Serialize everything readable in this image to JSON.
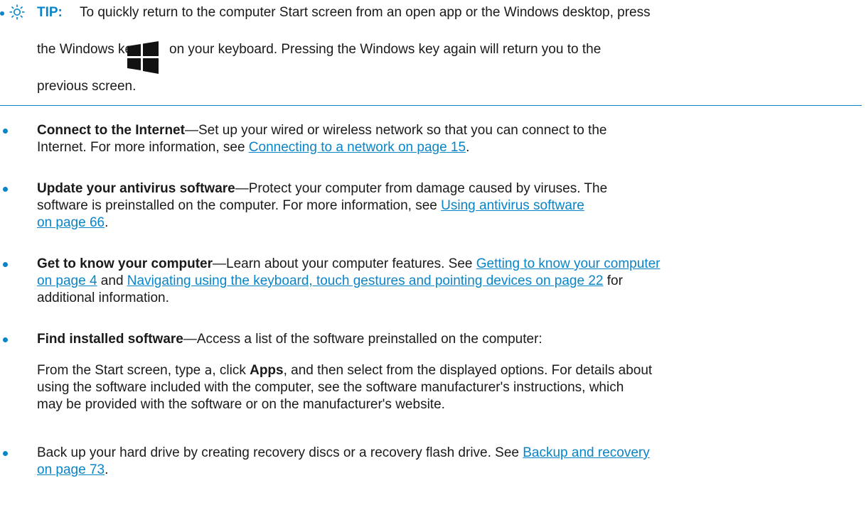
{
  "tip": {
    "label": "TIP:",
    "line1": "To quickly return to the computer Start screen from an open app or the Windows desktop, press",
    "line2a": "the Windows key",
    "line2b": "on your keyboard. Pressing the Windows key again will return you to the",
    "line3": "previous screen."
  },
  "items": [
    {
      "bold": "Connect to the Internet",
      "dash": "—",
      "text1": "Set up your wired or wireless network so that you can connect to the",
      "text2": "Internet. For more information, see ",
      "link1": "Connecting to a network on page 15",
      "end": "."
    },
    {
      "bold": "Update your antivirus software",
      "dash": "—",
      "text1": "Protect your computer from damage caused by viruses. The",
      "text2": "software is preinstalled on the computer. For more information, see ",
      "link1": "Using antivirus software",
      "link1b": "on page 66",
      "end": "."
    },
    {
      "bold": "Get to know your computer",
      "dash": "—",
      "text1": "Learn about your computer features. See ",
      "link1": "Getting to know your computer",
      "link1b": "on page 4",
      "mid": " and ",
      "link2": "Navigating using the keyboard, touch gestures and pointing devices on page 22",
      "text2": " for",
      "text3": "additional information."
    },
    {
      "bold": "Find installed software",
      "dash": "—",
      "text1": "Access a list of the software preinstalled on the computer:",
      "sub1a": "From the Start screen, type ",
      "sub_code": "a",
      "sub1b": ", click ",
      "sub_bold": "Apps",
      "sub1c": ", and then select from the displayed options. For details about",
      "sub2": "using the software included with the computer, see the software manufacturer's instructions, which",
      "sub3": "may be provided with the software or on the manufacturer's website."
    },
    {
      "text1": "Back up your hard drive by creating recovery discs or a recovery flash drive. See ",
      "link1": "Backup and recovery",
      "link1b": "on page 73",
      "end": "."
    }
  ]
}
